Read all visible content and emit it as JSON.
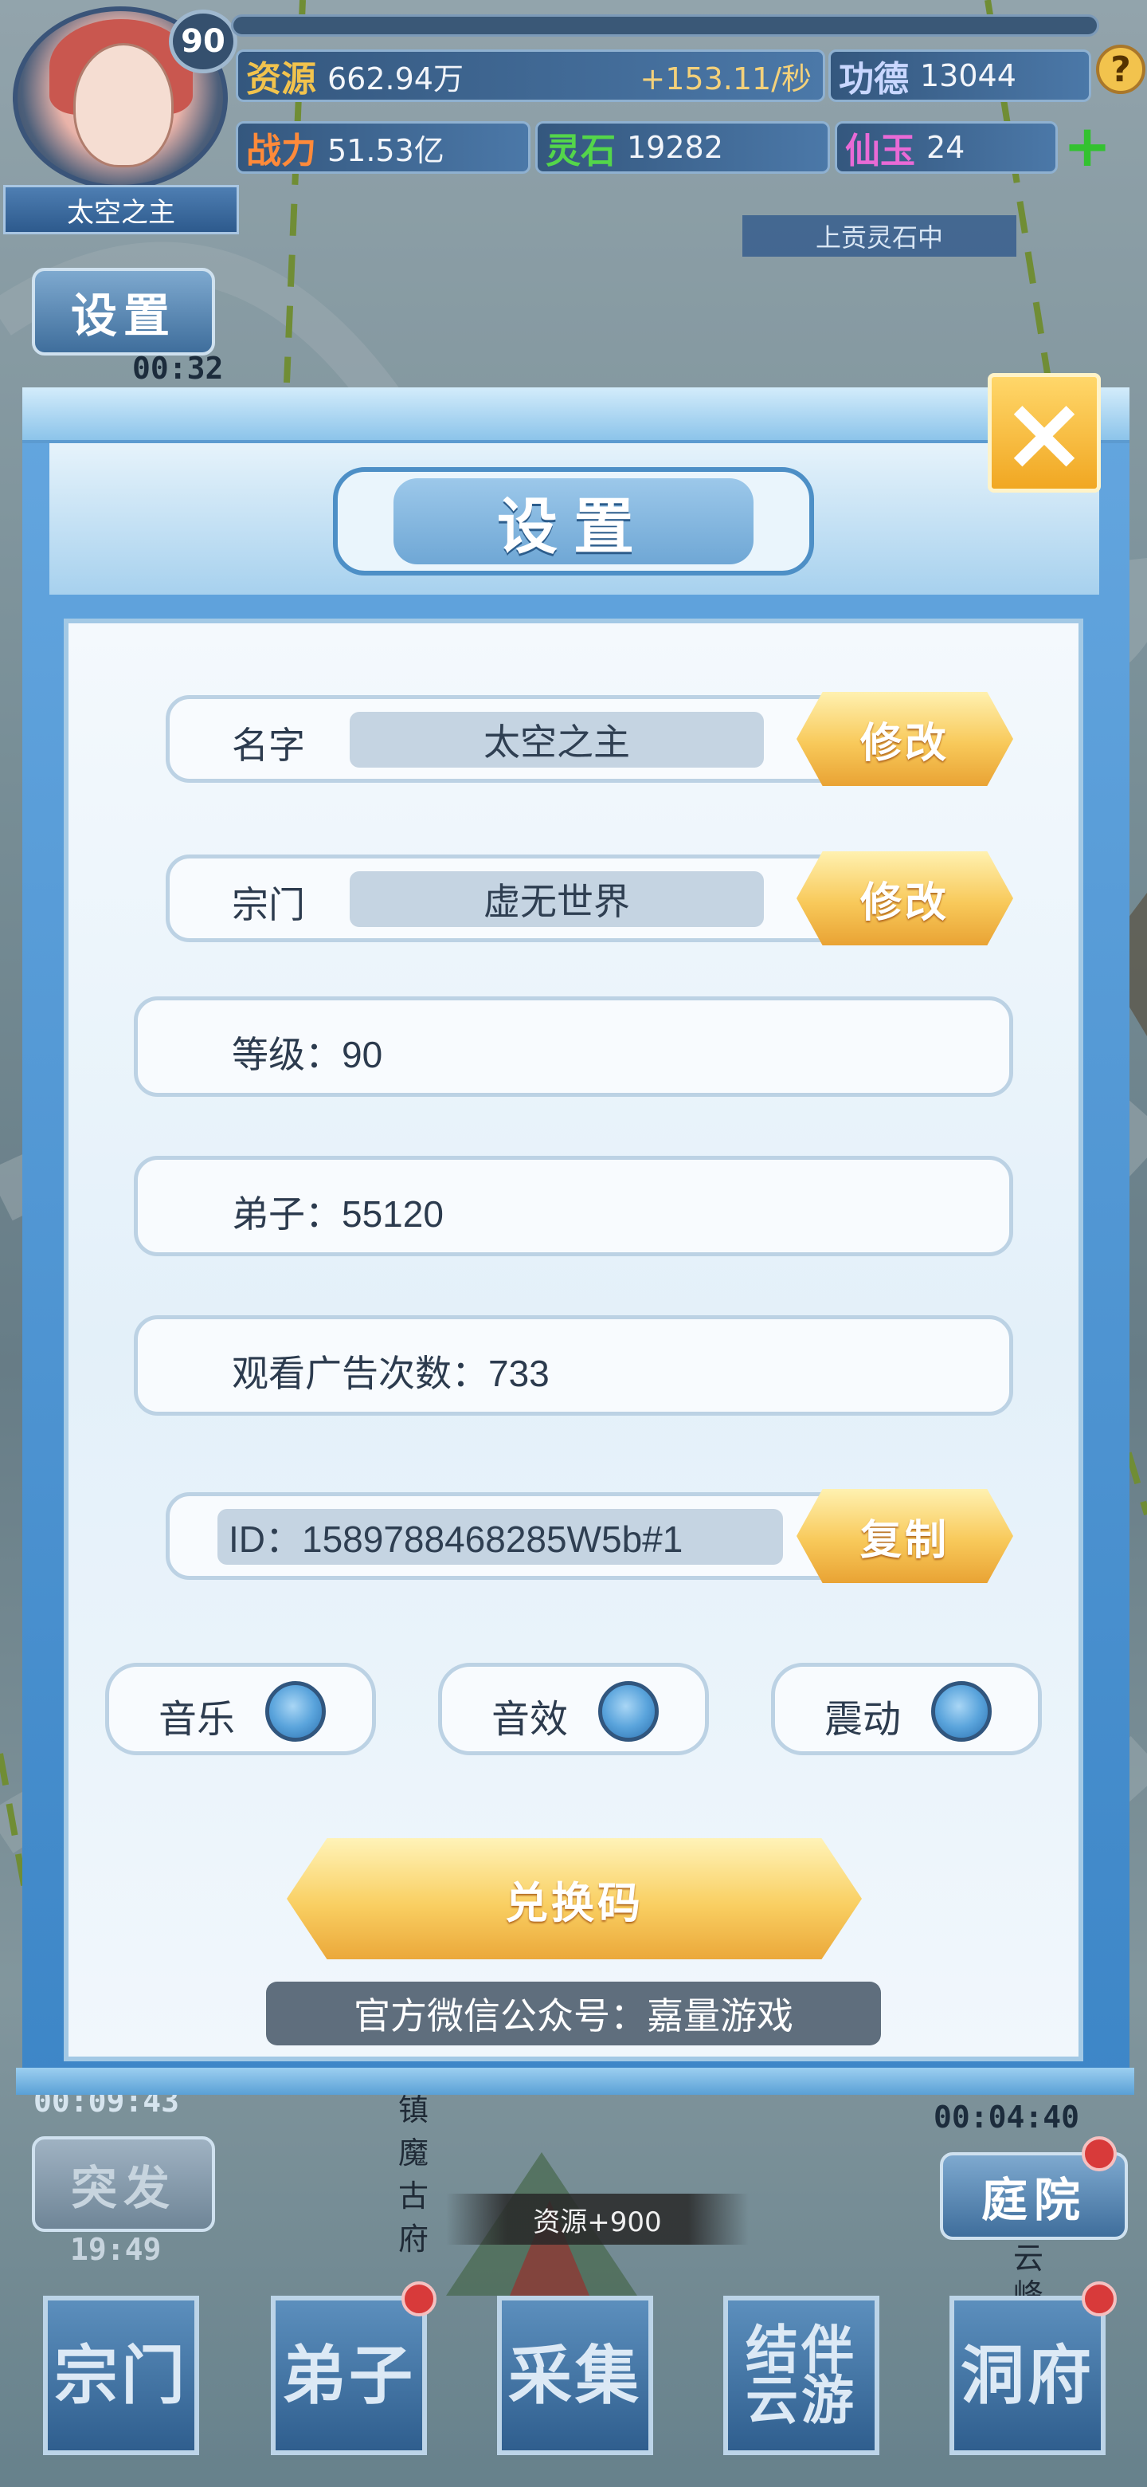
{
  "hud": {
    "player_name": "太空之主",
    "level": "90",
    "stats": {
      "resources_label": "资源",
      "resources_value": "662.94万",
      "resources_rate": "+153.11/秒",
      "merit_label": "功德",
      "merit_value": "13044",
      "power_label": "战力",
      "power_value": "51.53亿",
      "spirit_stone_label": "灵石",
      "spirit_stone_value": "19282",
      "jade_label": "仙玉",
      "jade_value": "24"
    },
    "help_icon": "question-icon",
    "add_icon": "plus-icon",
    "tribute_status": "上贡灵石中",
    "settings_shortcut": "设置",
    "settings_timer": "00:32"
  },
  "map": {
    "left_timer": "00:09:43",
    "burst_label": "突发",
    "burst_timer": "19:49",
    "right_timer": "00:04:40",
    "courtyard_label": "庭院",
    "temple_name": "镇魔古府",
    "peak_label": "云峰",
    "resource_popup": "资源+900"
  },
  "bottom_nav": [
    {
      "label": "宗门"
    },
    {
      "label": "弟子"
    },
    {
      "label": "采集"
    },
    {
      "label": "结伴云游"
    },
    {
      "label": "洞府"
    }
  ],
  "dialog": {
    "title": "设置",
    "close_icon": "close-icon",
    "name_row": {
      "label": "名字",
      "value": "太空之主",
      "button": "修改"
    },
    "sect_row": {
      "label": "宗门",
      "value": "虚无世界",
      "button": "修改"
    },
    "level_row": {
      "text": "等级：90"
    },
    "disciples_row": {
      "text": "弟子：55120"
    },
    "ads_row": {
      "text": "观看广告次数：733"
    },
    "id_row": {
      "value": "ID：1589788468285W5b#1",
      "button": "复制"
    },
    "toggles": [
      {
        "label": "音乐",
        "state": "on"
      },
      {
        "label": "音效",
        "state": "on"
      },
      {
        "label": "震动",
        "state": "on"
      }
    ],
    "redeem_button": "兑换码",
    "official_account": "官方微信公众号：嘉量游戏"
  },
  "colors": {
    "accent_blue": "#4d8fc6",
    "gold_button": "#f8c95a",
    "panel_bg": "#f4f9fd"
  }
}
